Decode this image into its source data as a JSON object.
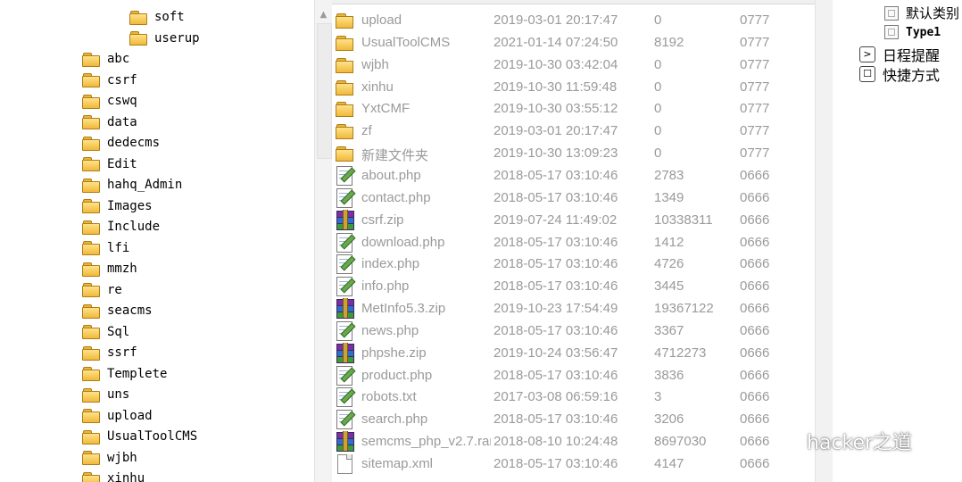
{
  "tree": {
    "items": [
      {
        "label": "soft",
        "indent": 2
      },
      {
        "label": "userup",
        "indent": 2
      },
      {
        "label": "abc",
        "indent": 1
      },
      {
        "label": "csrf",
        "indent": 1
      },
      {
        "label": "cswq",
        "indent": 1
      },
      {
        "label": "data",
        "indent": 1
      },
      {
        "label": "dedecms",
        "indent": 1
      },
      {
        "label": "Edit",
        "indent": 1
      },
      {
        "label": "hahq_Admin",
        "indent": 1
      },
      {
        "label": "Images",
        "indent": 1
      },
      {
        "label": "Include",
        "indent": 1
      },
      {
        "label": "lfi",
        "indent": 1
      },
      {
        "label": "mmzh",
        "indent": 1
      },
      {
        "label": "re",
        "indent": 1
      },
      {
        "label": "seacms",
        "indent": 1
      },
      {
        "label": "Sql",
        "indent": 1
      },
      {
        "label": "ssrf",
        "indent": 1
      },
      {
        "label": "Templete",
        "indent": 1
      },
      {
        "label": "uns",
        "indent": 1
      },
      {
        "label": "upload",
        "indent": 1
      },
      {
        "label": "UsualToolCMS",
        "indent": 1
      },
      {
        "label": "wjbh",
        "indent": 1
      },
      {
        "label": "xinhu",
        "indent": 1
      }
    ]
  },
  "files": [
    {
      "name": "upload",
      "type": "folder",
      "date": "2019-03-01 20:17:47",
      "size": "0",
      "perm": "0777"
    },
    {
      "name": "UsualToolCMS",
      "type": "folder",
      "date": "2021-01-14 07:24:50",
      "size": "8192",
      "perm": "0777"
    },
    {
      "name": "wjbh",
      "type": "folder",
      "date": "2019-10-30 03:42:04",
      "size": "0",
      "perm": "0777"
    },
    {
      "name": "xinhu",
      "type": "folder",
      "date": "2019-10-30 11:59:48",
      "size": "0",
      "perm": "0777"
    },
    {
      "name": "YxtCMF",
      "type": "folder",
      "date": "2019-10-30 03:55:12",
      "size": "0",
      "perm": "0777"
    },
    {
      "name": "zf",
      "type": "folder",
      "date": "2019-03-01 20:17:47",
      "size": "0",
      "perm": "0777"
    },
    {
      "name": "新建文件夹",
      "type": "folder",
      "date": "2019-10-30 13:09:23",
      "size": "0",
      "perm": "0777"
    },
    {
      "name": "about.php",
      "type": "php",
      "date": "2018-05-17 03:10:46",
      "size": "2783",
      "perm": "0666"
    },
    {
      "name": "contact.php",
      "type": "php",
      "date": "2018-05-17 03:10:46",
      "size": "1349",
      "perm": "0666"
    },
    {
      "name": "csrf.zip",
      "type": "zip",
      "date": "2019-07-24 11:49:02",
      "size": "10338311",
      "perm": "0666"
    },
    {
      "name": "download.php",
      "type": "php",
      "date": "2018-05-17 03:10:46",
      "size": "1412",
      "perm": "0666"
    },
    {
      "name": "index.php",
      "type": "php",
      "date": "2018-05-17 03:10:46",
      "size": "4726",
      "perm": "0666"
    },
    {
      "name": "info.php",
      "type": "php",
      "date": "2018-05-17 03:10:46",
      "size": "3445",
      "perm": "0666"
    },
    {
      "name": "MetInfo5.3.zip",
      "type": "zip",
      "date": "2019-10-23 17:54:49",
      "size": "19367122",
      "perm": "0666"
    },
    {
      "name": "news.php",
      "type": "php",
      "date": "2018-05-17 03:10:46",
      "size": "3367",
      "perm": "0666"
    },
    {
      "name": "phpshe.zip",
      "type": "zip",
      "date": "2019-10-24 03:56:47",
      "size": "4712273",
      "perm": "0666"
    },
    {
      "name": "product.php",
      "type": "php",
      "date": "2018-05-17 03:10:46",
      "size": "3836",
      "perm": "0666"
    },
    {
      "name": "robots.txt",
      "type": "php",
      "date": "2017-03-08 06:59:16",
      "size": "3",
      "perm": "0666"
    },
    {
      "name": "search.php",
      "type": "php",
      "date": "2018-05-17 03:10:46",
      "size": "3206",
      "perm": "0666"
    },
    {
      "name": "semcms_php_v2.7.rar",
      "type": "zip",
      "date": "2018-08-10 10:24:48",
      "size": "8697030",
      "perm": "0666"
    },
    {
      "name": "sitemap.xml",
      "type": "file",
      "date": "2018-05-17 03:10:46",
      "size": "4147",
      "perm": "0666"
    }
  ],
  "right_panel": {
    "default_category": "默认类别",
    "type1": "Type1",
    "schedule_reminder": "日程提醒",
    "shortcut": "快捷方式"
  },
  "watermark": {
    "text": "hacker之道"
  },
  "colors": {
    "folder": "#f0b93a",
    "list_text": "#9a9a9a",
    "tree_text": "#000000"
  }
}
